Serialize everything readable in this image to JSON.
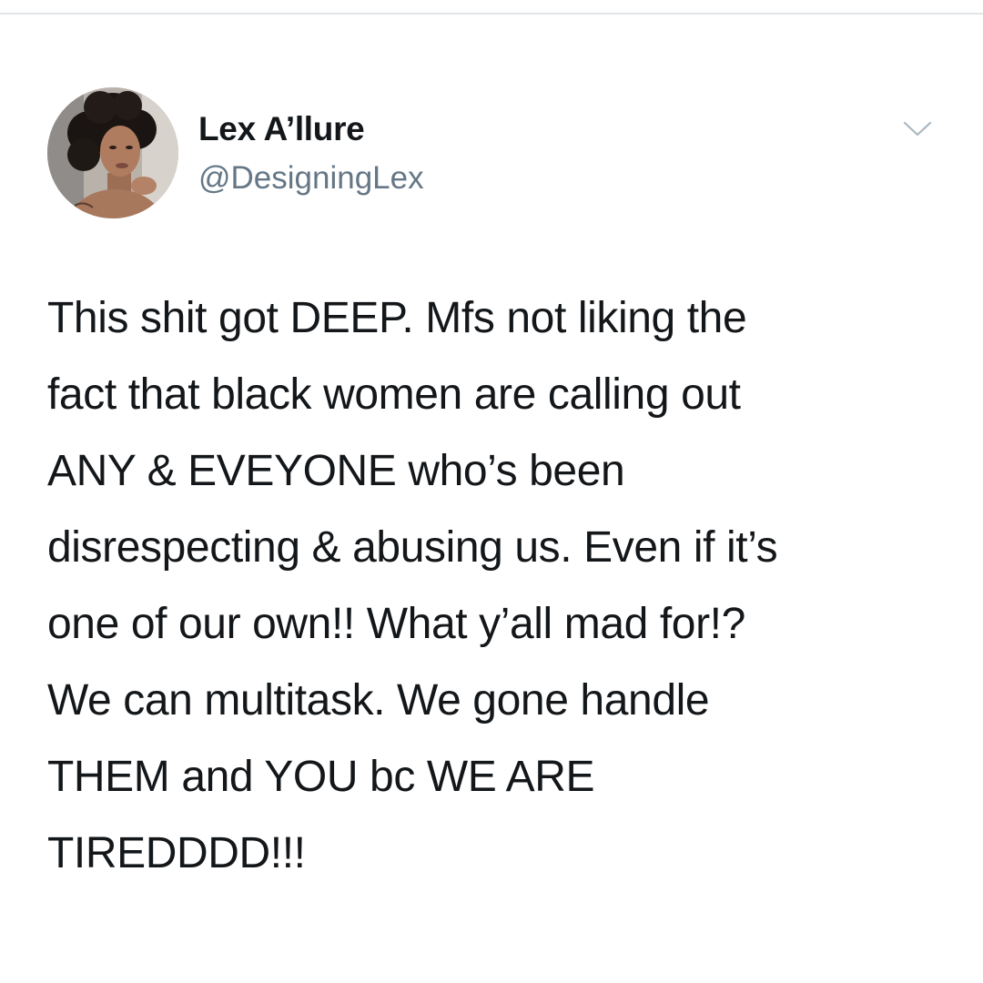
{
  "tweet": {
    "author": {
      "name": "Lex A’llure",
      "handle": "@DesigningLex",
      "avatar": "profile-photo"
    },
    "menu_icon": "chevron-down-icon",
    "text_lines": [
      "This shit got DEEP. Mfs not liking the",
      "fact that black women are calling out",
      "ANY & EVEYONE who’s been",
      "disrespecting & abusing us. Even if it’s",
      "one of our own!! What y’all mad for!?",
      "We can multitask. We gone handle",
      "THEM and YOU bc WE ARE",
      "TIREDDDD!!!"
    ]
  },
  "colors": {
    "text": "#14171a",
    "handle": "#657786",
    "divider": "#e3e6e8",
    "background": "#ffffff"
  }
}
